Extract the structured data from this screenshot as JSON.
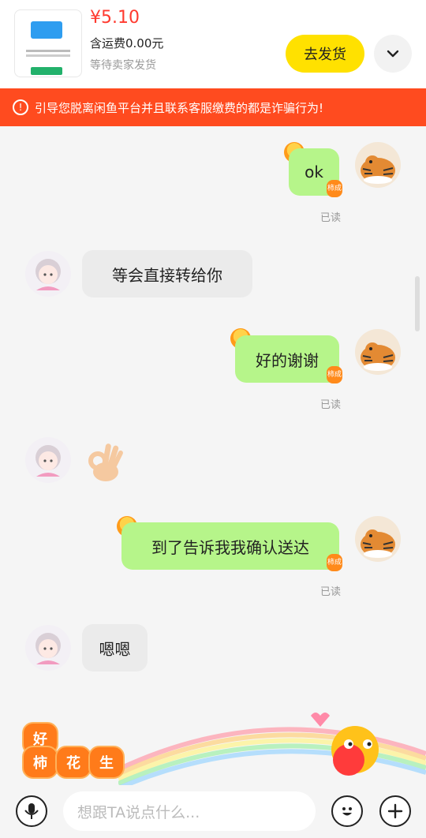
{
  "header": {
    "price": "¥5.10",
    "shipping": "含运费0.00元",
    "status": "等待卖家发货",
    "ship_button": "去发货",
    "expand_icon": "chevron-down-icon"
  },
  "warning": {
    "icon": "alert-circle-icon",
    "text": "引导您脱离闲鱼平台并且联系客服缴费的都是诈骗行为!"
  },
  "messages": [
    {
      "side": "out",
      "text": "ok",
      "read": "已读"
    },
    {
      "side": "in",
      "text": "等会直接转给你"
    },
    {
      "side": "out",
      "text": "好的谢谢",
      "read": "已读"
    },
    {
      "side": "in",
      "sticker": "ok-hand-emoji"
    },
    {
      "side": "out",
      "text": "到了告诉我我确认送达",
      "read": "已读"
    },
    {
      "side": "in",
      "text": "嗯嗯"
    }
  ],
  "badge": {
    "persimmon_top": "柿",
    "persimmon_bottom": "成"
  },
  "decoration": {
    "chars": [
      "好",
      "柿",
      "花",
      "生"
    ]
  },
  "input": {
    "placeholder": "想跟TA说点什么...",
    "voice_icon": "microphone-icon",
    "emoji_icon": "smiley-icon",
    "add_icon": "plus-icon"
  },
  "colors": {
    "accent_yellow": "#ffe100",
    "warning_red": "#ff4b1f",
    "bubble_green": "#b6f58a",
    "price_red": "#ff3a2f"
  }
}
